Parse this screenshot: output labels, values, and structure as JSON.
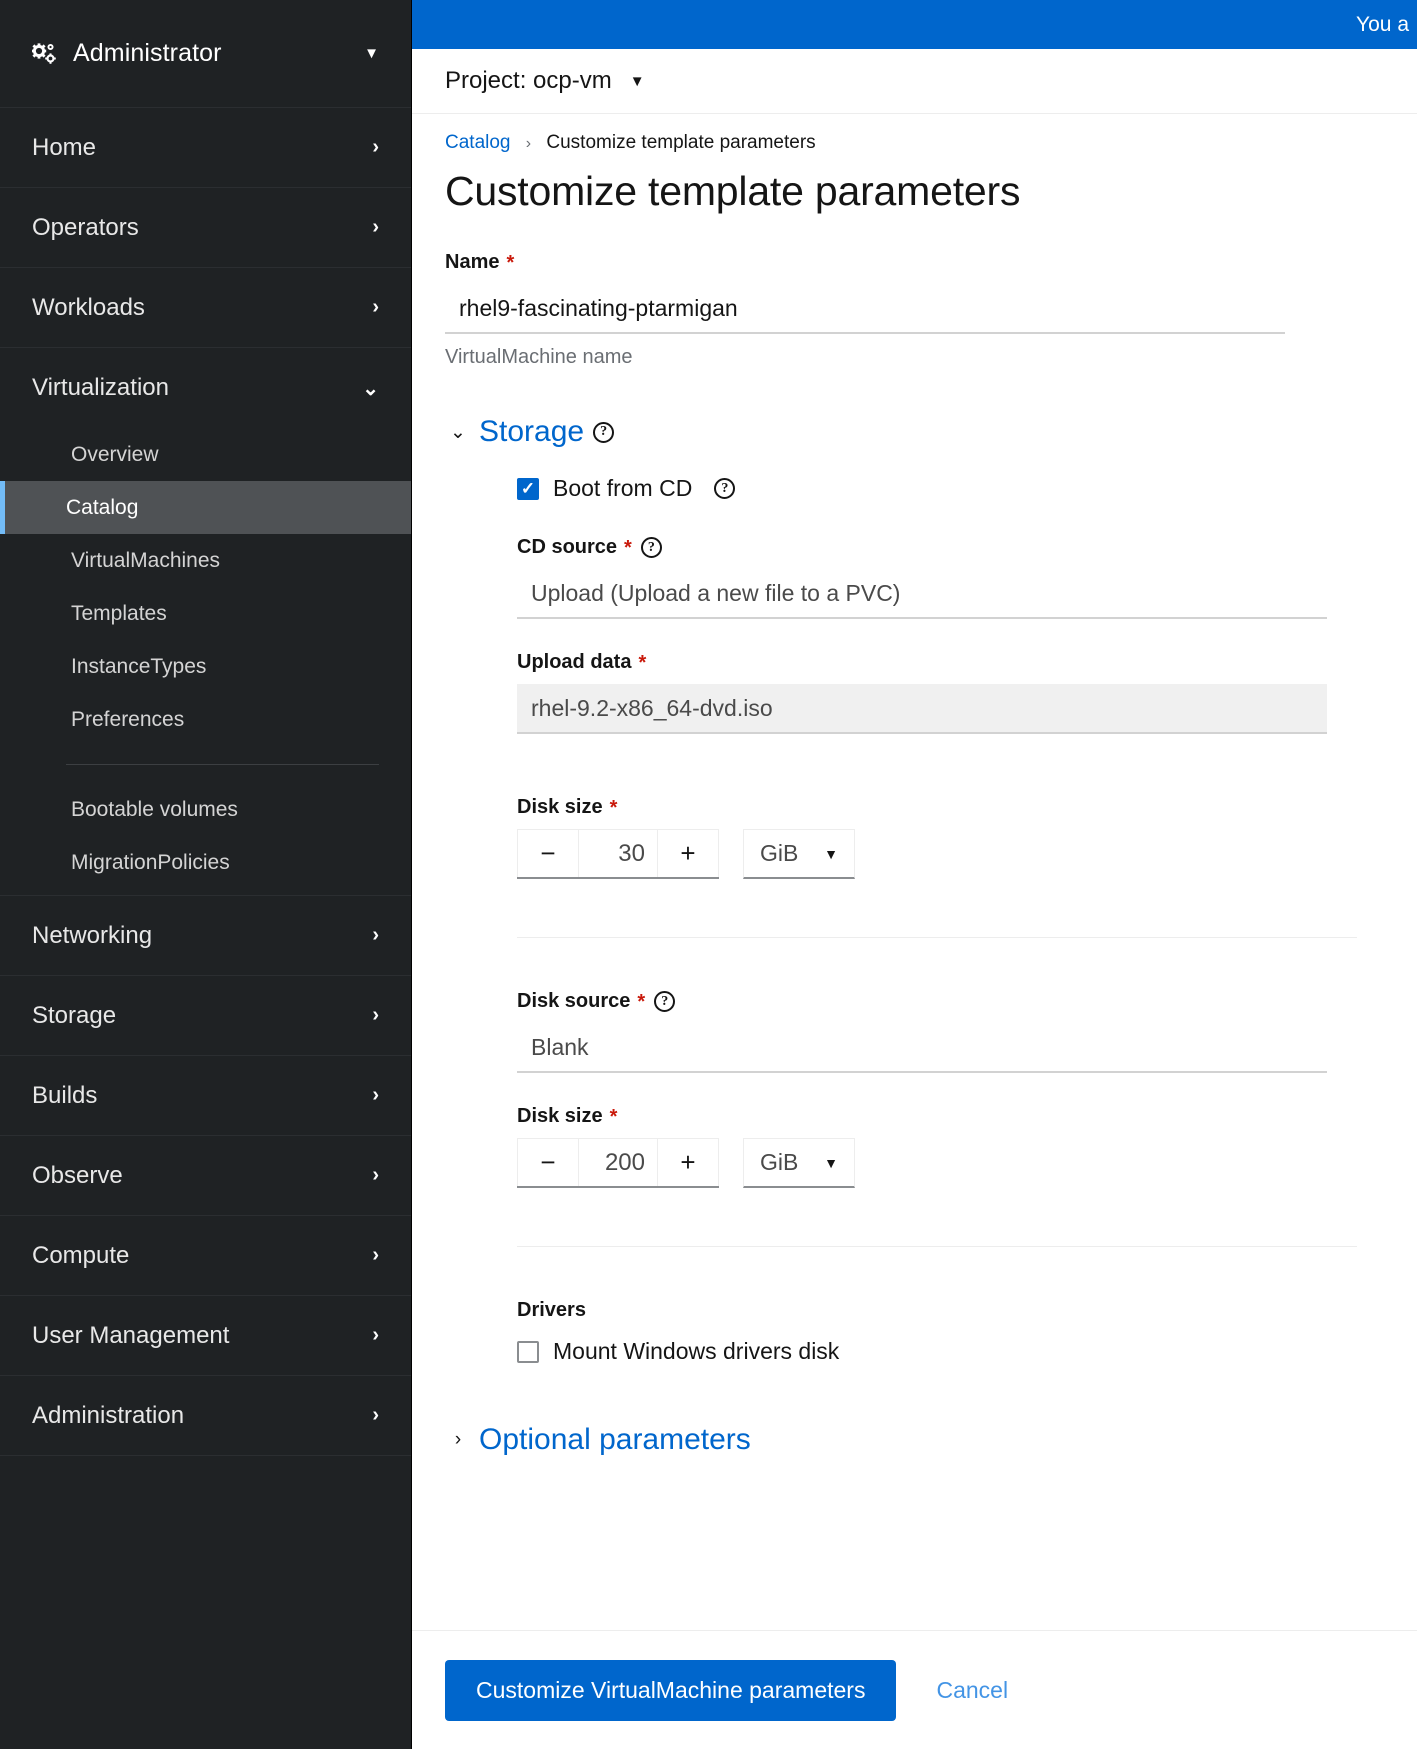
{
  "sidebar": {
    "perspective": {
      "label": "Administrator",
      "icon": "cogs-icon",
      "caret": "▼"
    },
    "items": [
      {
        "label": "Home",
        "chevron": "›"
      },
      {
        "label": "Operators",
        "chevron": "›"
      },
      {
        "label": "Workloads",
        "chevron": "›"
      },
      {
        "label": "Virtualization",
        "chevron": "⌄"
      },
      {
        "label": "Networking",
        "chevron": "›"
      },
      {
        "label": "Storage",
        "chevron": "›"
      },
      {
        "label": "Builds",
        "chevron": "›"
      },
      {
        "label": "Observe",
        "chevron": "›"
      },
      {
        "label": "Compute",
        "chevron": "›"
      },
      {
        "label": "User Management",
        "chevron": "›"
      },
      {
        "label": "Administration",
        "chevron": "›"
      }
    ],
    "virtualization_subitems": [
      {
        "label": "Overview",
        "active": false
      },
      {
        "label": "Catalog",
        "active": true
      },
      {
        "label": "VirtualMachines",
        "active": false
      },
      {
        "label": "Templates",
        "active": false
      },
      {
        "label": "InstanceTypes",
        "active": false
      },
      {
        "label": "Preferences",
        "active": false
      }
    ],
    "virtualization_subitems2": [
      {
        "label": "Bootable volumes",
        "active": false
      },
      {
        "label": "MigrationPolicies",
        "active": false
      }
    ],
    "active_accent": "#73bcf7",
    "background": "#1f2224"
  },
  "banner": {
    "text": "You a"
  },
  "project_bar": {
    "label": "Project: ocp-vm",
    "caret": "▼"
  },
  "breadcrumb": {
    "parent": "Catalog",
    "separator": "›",
    "current": "Customize template parameters"
  },
  "page": {
    "title": "Customize template parameters"
  },
  "name_field": {
    "label": "Name",
    "required_marker": "*",
    "value": "rhel9-fascinating-ptarmigan",
    "placeholder": "",
    "helper": "VirtualMachine name"
  },
  "storage": {
    "toggle": "⌄",
    "title": "Storage",
    "help": "?",
    "boot_from_cd": {
      "label": "Boot from CD",
      "checked": true,
      "help": "?"
    },
    "cd_source": {
      "label": "CD source",
      "required_marker": "*",
      "help": "?",
      "value": "Upload (Upload a new file to a PVC)"
    },
    "upload_data": {
      "label": "Upload data",
      "required_marker": "*",
      "value": "rhel-9.2-x86_64-dvd.iso"
    },
    "cd_disk_size": {
      "label": "Disk size",
      "required_marker": "*",
      "minus": "−",
      "value": "30",
      "plus": "+",
      "unit": "GiB",
      "unit_caret": "▼"
    },
    "disk_source": {
      "label": "Disk source",
      "required_marker": "*",
      "help": "?",
      "value": "Blank"
    },
    "disk_size": {
      "label": "Disk size",
      "required_marker": "*",
      "minus": "−",
      "value": "200",
      "plus": "+",
      "unit": "GiB",
      "unit_caret": "▼"
    },
    "drivers": {
      "label": "Drivers",
      "checkbox_label": "Mount Windows drivers disk",
      "checked": false
    }
  },
  "optional": {
    "toggle": "›",
    "title": "Optional parameters"
  },
  "footer": {
    "submit": "Customize VirtualMachine parameters",
    "cancel": "Cancel"
  },
  "colors": {
    "primary": "#0066cc",
    "link": "#06c",
    "required": "#c9190b"
  }
}
